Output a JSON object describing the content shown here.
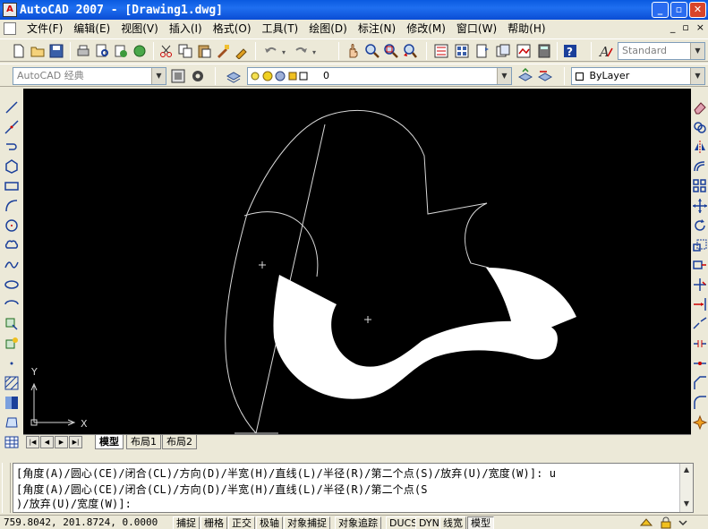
{
  "window": {
    "title": "AutoCAD 2007 - [Drawing1.dwg]",
    "app_icon_letter": "A",
    "controls": {
      "minimize": "_",
      "restore": "▫",
      "close": "✕"
    }
  },
  "menu": {
    "items": [
      "文件(F)",
      "编辑(E)",
      "视图(V)",
      "插入(I)",
      "格式(O)",
      "工具(T)",
      "绘图(D)",
      "标注(N)",
      "修改(M)",
      "窗口(W)",
      "帮助(H)"
    ],
    "mdi_controls": {
      "minimize": "_",
      "restore": "▫",
      "close": "×"
    }
  },
  "toolbar": {
    "text_style": "Standard",
    "workspace": "AutoCAD 经典",
    "layer": "0",
    "color": "ByLayer"
  },
  "tabs": [
    "模型",
    "布局1",
    "布局2"
  ],
  "nav": [
    "|◀",
    "◀",
    "▶",
    "▶|"
  ],
  "ucs": {
    "x": "X",
    "y": "Y"
  },
  "command": {
    "lines": [
      "[角度(A)/圆心(CE)/闭合(CL)/方向(D)/半宽(H)/直线(L)/半径(R)/第二个点(S)/放弃(U)/宽度(W)]: u",
      "[角度(A)/圆心(CE)/闭合(CL)/方向(D)/半宽(H)/直线(L)/半径(R)/第二个点(S",
      ")/放弃(U)/宽度(W)]:"
    ]
  },
  "status": {
    "coords": "759.8042, 201.8724, 0.0000",
    "toggles": [
      {
        "label": "捕捉",
        "on": false
      },
      {
        "label": "栅格",
        "on": false
      },
      {
        "label": "正交",
        "on": false
      },
      {
        "label": "极轴",
        "on": false
      },
      {
        "label": "对象捕捉",
        "on": false
      },
      {
        "label": "对象追踪",
        "on": false
      },
      {
        "label": "DUCS",
        "on": false
      },
      {
        "label": "DYN",
        "on": false
      },
      {
        "label": "线宽",
        "on": false
      },
      {
        "label": "模型",
        "on": true
      }
    ]
  },
  "icons": {
    "toolbar1": [
      "new-icon",
      "open-icon",
      "save-icon",
      "plot-icon",
      "plot-preview-icon",
      "publish-icon",
      "cut-icon",
      "copy-icon",
      "paste-icon",
      "match-properties-icon",
      "undo-icon",
      "redo-icon",
      "pan-icon",
      "zoom-realtime-icon",
      "zoom-window-icon",
      "zoom-previous-icon",
      "properties-icon",
      "design-center-icon",
      "tool-palettes-icon",
      "sheet-set-icon",
      "markup-icon",
      "calculator-icon",
      "help-icon",
      "text-style-icon"
    ],
    "left": [
      "line-icon",
      "construction-line-icon",
      "polyline-icon",
      "polygon-icon",
      "rectangle-icon",
      "arc-icon",
      "circle-icon",
      "revision-cloud-icon",
      "spline-icon",
      "ellipse-icon",
      "ellipse-arc-icon",
      "insert-block-icon",
      "make-block-icon",
      "point-icon",
      "hatch-icon",
      "gradient-icon",
      "region-icon",
      "table-icon"
    ],
    "right": [
      "erase-icon",
      "copy-object-icon",
      "mirror-icon",
      "offset-icon",
      "array-icon",
      "move-icon",
      "rotate-icon",
      "scale-icon",
      "stretch-icon",
      "trim-icon",
      "extend-icon",
      "break-at-point-icon",
      "break-icon",
      "join-icon",
      "chamfer-icon",
      "fillet-icon",
      "explode-icon"
    ]
  }
}
